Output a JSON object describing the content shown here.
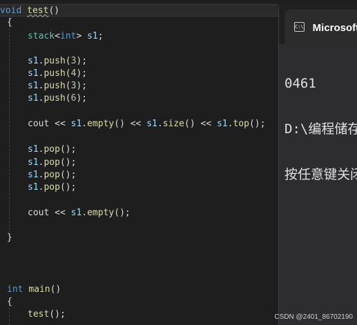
{
  "code": {
    "l1_kw": "void",
    "l1_fn": "test",
    "l1_paren": "()",
    "open_brace": "{",
    "close_brace": "}",
    "stack_type": "stack",
    "stack_lt": "<",
    "stack_int": "int",
    "stack_gt": ">",
    "stack_var": "s1",
    "semicolon": ";",
    "push_lines": [
      {
        "obj": "s1",
        "dot": ".",
        "fn": "push",
        "open": "(",
        "arg": "3",
        "close": ");"
      },
      {
        "obj": "s1",
        "dot": ".",
        "fn": "push",
        "open": "(",
        "arg": "4",
        "close": ");"
      },
      {
        "obj": "s1",
        "dot": ".",
        "fn": "push",
        "open": "(",
        "arg": "3",
        "close": ");"
      },
      {
        "obj": "s1",
        "dot": ".",
        "fn": "push",
        "open": "(",
        "arg": "6",
        "close": ");"
      }
    ],
    "cout_line": {
      "cout": "cout",
      "op1": " << ",
      "obj1": "s1",
      "fn1": ".empty",
      "p1": "()",
      "op2": " << ",
      "obj2": "s1",
      "fn2": ".size",
      "p2": "()",
      "op3": " << ",
      "obj3": "s1",
      "fn3": ".top",
      "p3": "();"
    },
    "pop_lines": [
      {
        "obj": "s1",
        "fn": ".pop",
        "p": "();"
      },
      {
        "obj": "s1",
        "fn": ".pop",
        "p": "();"
      },
      {
        "obj": "s1",
        "fn": ".pop",
        "p": "();"
      },
      {
        "obj": "s1",
        "fn": ".pop",
        "p": "();"
      }
    ],
    "cout2": {
      "cout": "cout",
      "op": " << ",
      "obj": "s1",
      "fn": ".empty",
      "p": "();"
    },
    "main_kw": "int",
    "main_fn": "main",
    "main_paren": "()",
    "call_fn": "test",
    "call_p": "();"
  },
  "console": {
    "tab_title": "Microsoft Visual Studio 调试控制台",
    "icon_text": "C:\\",
    "output": [
      "0461",
      "D:\\编程储存",
      "按任意键关闭"
    ]
  },
  "watermark": "CSDN @2401_86702190"
}
